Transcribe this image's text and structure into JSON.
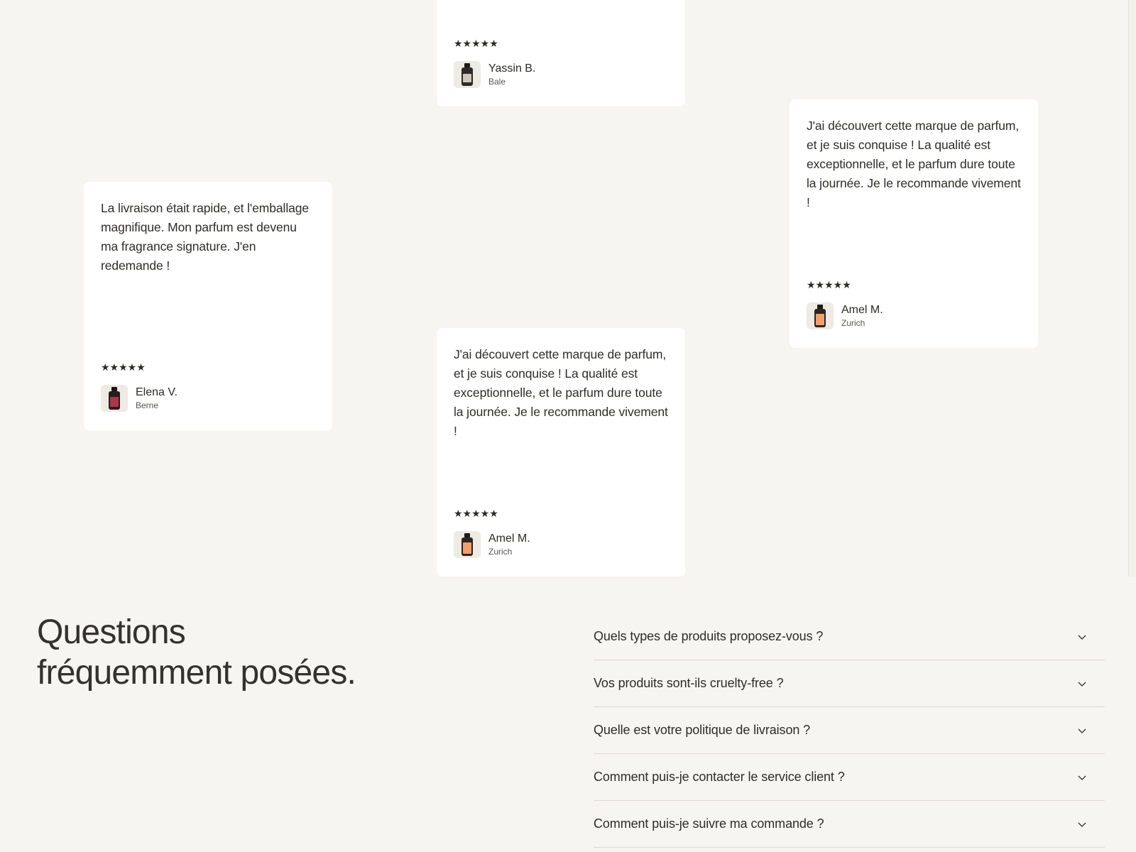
{
  "reviews": [
    {
      "id": "yassin",
      "text": "",
      "stars": "★★★★★",
      "name": "Yassin B.",
      "city": "Bale",
      "bottle_color": "#3a2e2a",
      "label_color": "#d8d2c8"
    },
    {
      "id": "elena",
      "text": "La livraison était rapide, et l'emballage magnifique. Mon parfum est devenu ma fragrance signature. J'en redemande !",
      "stars": "★★★★★",
      "name": "Elena V.",
      "city": "Berne",
      "bottle_color": "#2b1e20",
      "label_color": "#a8394a"
    },
    {
      "id": "amel-center",
      "text": "J'ai découvert cette marque de parfum, et je suis conquise ! La qualité est exceptionnelle, et le parfum dure toute la journée. Je le recommande vivement !",
      "stars": "★★★★★",
      "name": "Amel M.",
      "city": "Zurich",
      "bottle_color": "#2e2420",
      "label_color": "#f0a070"
    },
    {
      "id": "amel-right",
      "text": "J'ai découvert cette marque de parfum, et je suis conquise ! La qualité est exceptionnelle, et le parfum dure toute la journée. Je le recommande vivement !",
      "stars": "★★★★★",
      "name": "Amel M.",
      "city": "Zurich",
      "bottle_color": "#2e2420",
      "label_color": "#f0a070"
    }
  ],
  "faq": {
    "title_line1": "Questions",
    "title_line2": "fréquemment posées.",
    "items": [
      "Quels types de produits proposez-vous ?",
      "Vos produits sont-ils cruelty-free ?",
      "Quelle est votre politique de livraison ?",
      "Comment puis-je contacter le service client ?",
      "Comment puis-je suivre ma commande ?"
    ],
    "chevron_icon": "chevron-down-icon"
  },
  "colors": {
    "background": "#f7f5f1",
    "card": "#ffffff",
    "text": "#2e2d29",
    "divider": "#dcd9d2"
  }
}
